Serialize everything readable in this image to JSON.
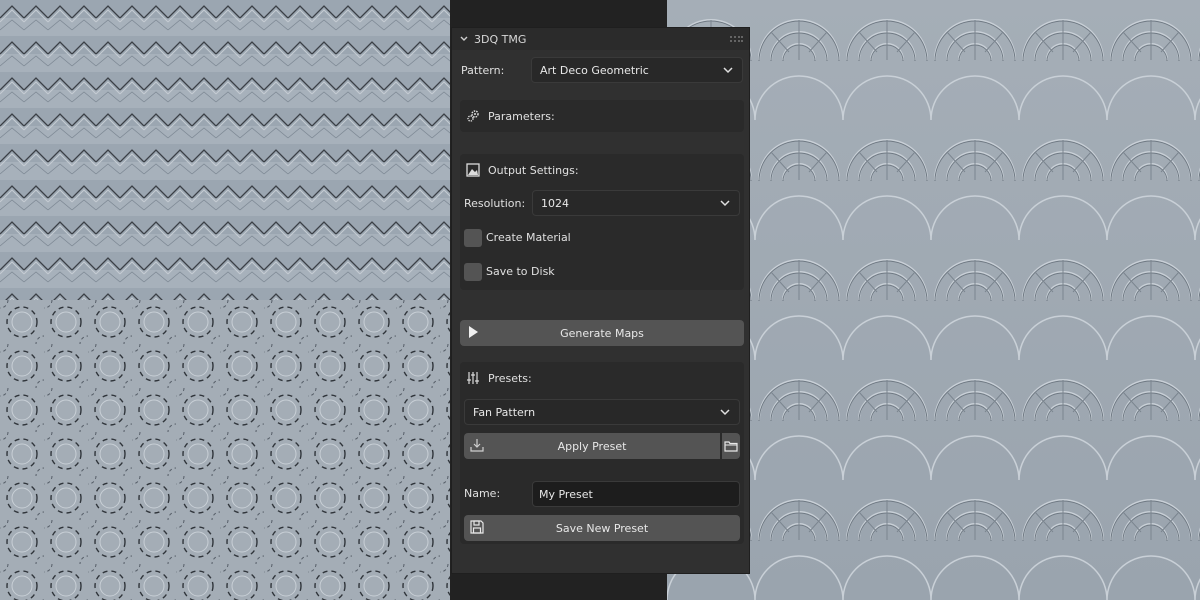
{
  "panel": {
    "title": "3DQ TMG",
    "pattern_label": "Pattern:",
    "pattern_value": "Art Deco Geometric",
    "parameters_title": "Parameters:",
    "output": {
      "title": "Output Settings:",
      "resolution_label": "Resolution:",
      "resolution_value": "1024",
      "create_material_label": "Create Material",
      "create_material_checked": false,
      "save_to_disk_label": "Save to Disk",
      "save_to_disk_checked": false
    },
    "generate_label": "Generate Maps",
    "presets": {
      "title": "Presets:",
      "selected": "Fan Pattern",
      "apply_label": "Apply Preset",
      "name_label": "Name:",
      "name_value": "My Preset",
      "save_label": "Save New Preset"
    }
  },
  "icons": {
    "collapse": "chevron-down-icon",
    "grip": "drag-grip-icon",
    "parameters": "gears-icon",
    "output": "image-icon",
    "generate": "play-icon",
    "presets": "sliders-icon",
    "apply": "download-icon",
    "folder": "folder-icon",
    "save": "floppy-disk-icon"
  }
}
